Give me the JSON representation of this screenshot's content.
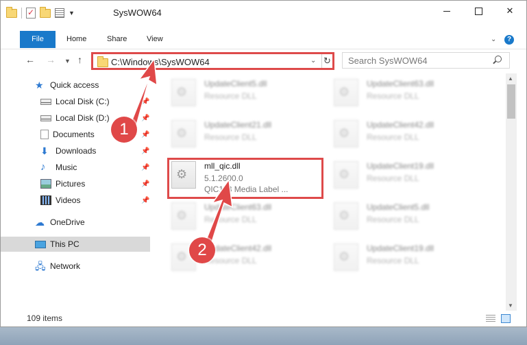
{
  "window": {
    "title": "SysWOW64",
    "ribbon_tabs": [
      "File",
      "Home",
      "Share",
      "View"
    ],
    "help": "?"
  },
  "nav": {
    "address": "C:\\Windows\\SysWOW64",
    "search_placeholder": "Search SysWOW64"
  },
  "sidebar": {
    "items": [
      {
        "label": "Quick access",
        "icon": "star-icon"
      },
      {
        "label": "Local Disk (C:)",
        "icon": "drive-icon"
      },
      {
        "label": "Local Disk (D:)",
        "icon": "drive-icon"
      },
      {
        "label": "Documents",
        "icon": "documents-icon"
      },
      {
        "label": "Downloads",
        "icon": "downloads-icon"
      },
      {
        "label": "Music",
        "icon": "music-icon"
      },
      {
        "label": "Pictures",
        "icon": "pictures-icon"
      },
      {
        "label": "Videos",
        "icon": "videos-icon"
      },
      {
        "label": "OneDrive",
        "icon": "cloud-icon"
      },
      {
        "label": "This PC",
        "icon": "computer-icon"
      },
      {
        "label": "Network",
        "icon": "network-icon"
      }
    ]
  },
  "files": [
    {
      "name": "UpdateClient5.dll",
      "type": "Resource DLL"
    },
    {
      "name": "UpdateClient63.dll",
      "type": "Resource DLL"
    },
    {
      "name": "UpdateClient21.dll",
      "type": "Resource DLL"
    },
    {
      "name": "UpdateClient42.dll",
      "type": "Resource DLL"
    },
    {
      "name": "mll_qic.dll",
      "type": "5.1.2600.0",
      "desc": "QIC113 Media Label ..."
    },
    {
      "name": "UpdateClient19.dll",
      "type": "Resource DLL"
    },
    {
      "name": "UpdateClient63.dll",
      "type": "Resource DLL"
    },
    {
      "name": "UpdateClient5.dll",
      "type": "Resource DLL"
    },
    {
      "name": "UpdateClient42.dll",
      "type": "Resource DLL"
    },
    {
      "name": "UpdateClient19.dll",
      "type": "Resource DLL"
    }
  ],
  "status": {
    "item_count": "109 items"
  },
  "annotations": {
    "step1": "1",
    "step2": "2",
    "color": "#e04848"
  }
}
